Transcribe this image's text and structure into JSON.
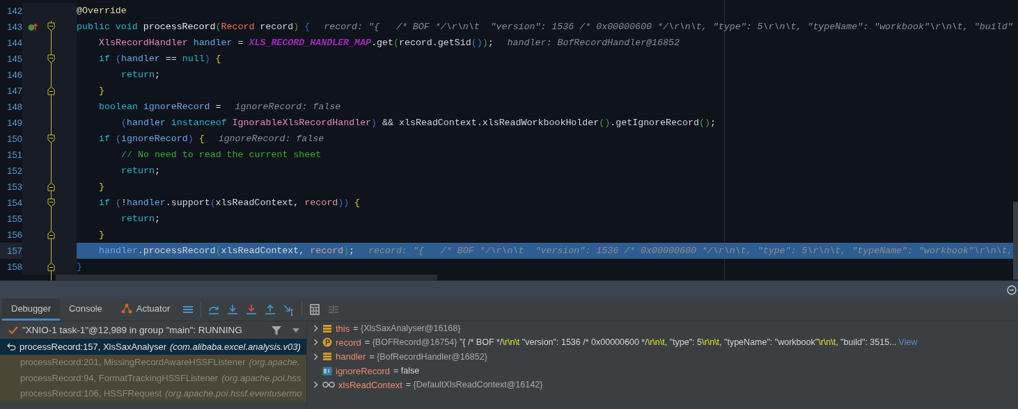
{
  "editor": {
    "lines": [
      {
        "number": "142",
        "fold_start": false,
        "fold_end": false,
        "overrides": false,
        "current": false,
        "tokens": [
          {
            "text": "@Override",
            "kind": "annotation"
          }
        ]
      },
      {
        "number": "143",
        "fold_start": true,
        "fold_end": false,
        "overrides": true,
        "current": false,
        "tokens": [
          {
            "text": "public void ",
            "kind": "kw"
          },
          {
            "text": "processRecord",
            "kind": "decl"
          },
          {
            "text": "(",
            "kind": "paren"
          },
          {
            "text": "Record",
            "kind": "type"
          },
          {
            "text": " record",
            "kind": "plain"
          },
          {
            "text": ")",
            "kind": "paren"
          },
          {
            "text": " {",
            "kind": "brace"
          }
        ],
        "hint": "record: \"{   /* BOF */\\r\\n\\t  \"version\": 1536 /* 0x00000600 */\\r\\n\\t, \"type\": 5\\r\\n\\t, \"typeName\": \"workbook\"\\r\\n\\t, \"build\"",
        "children": [
          {
            "number": "144",
            "fold_start": false,
            "fold_end": false,
            "overrides": false,
            "current": false,
            "tokens": [
              {
                "text": "XlsRecordHandler",
                "kind": "cls"
              },
              {
                "text": " handler",
                "kind": "local"
              },
              {
                "text": " = ",
                "kind": "plain"
              },
              {
                "text": "XLS_RECORD_HANDLER_MAP",
                "kind": "field"
              },
              {
                "text": ".get",
                "kind": "plain"
              },
              {
                "text": "(",
                "kind": "paren"
              },
              {
                "text": "record.getSid",
                "kind": "plain"
              },
              {
                "text": "()",
                "kind": "paren2"
              },
              {
                "text": ")",
                "kind": "paren"
              },
              {
                "text": ";",
                "kind": "plain"
              }
            ],
            "hint": "handler: BofRecordHandler@16852"
          },
          {
            "number": "145",
            "fold_start": true,
            "fold_end": false,
            "overrides": false,
            "current": false,
            "tokens": [
              {
                "text": "if ",
                "kind": "kw"
              },
              {
                "text": "(",
                "kind": "paren2"
              },
              {
                "text": "handler",
                "kind": "local"
              },
              {
                "text": " == ",
                "kind": "plain"
              },
              {
                "text": "null",
                "kind": "kw"
              },
              {
                "text": ")",
                "kind": "paren2"
              },
              {
                "text": " {",
                "kind": "brace2"
              }
            ],
            "children": [
              {
                "number": "146",
                "fold_start": false,
                "fold_end": false,
                "overrides": false,
                "current": false,
                "tokens": [
                  {
                    "text": "return",
                    "kind": "kw"
                  },
                  {
                    "text": ";",
                    "kind": "plain"
                  }
                ]
              }
            ]
          },
          {
            "number": "147",
            "fold_start": false,
            "fold_end": true,
            "overrides": false,
            "current": false,
            "tokens": [
              {
                "text": "}",
                "kind": "brace2"
              }
            ]
          },
          {
            "number": "148",
            "fold_start": false,
            "fold_end": false,
            "overrides": false,
            "current": false,
            "tokens": [
              {
                "text": "boolean ",
                "kind": "kw"
              },
              {
                "text": "ignoreRecord",
                "kind": "local"
              },
              {
                "text": " =",
                "kind": "plain"
              }
            ],
            "hint": "ignoreRecord: false",
            "children": [
              {
                "number": "149",
                "fold_start": false,
                "fold_end": false,
                "overrides": false,
                "current": false,
                "tokens": [
                  {
                    "text": "(",
                    "kind": "paren2"
                  },
                  {
                    "text": "handler",
                    "kind": "local"
                  },
                  {
                    "text": " instanceof ",
                    "kind": "kw"
                  },
                  {
                    "text": "IgnorableXlsRecordHandler",
                    "kind": "cls"
                  },
                  {
                    "text": ")",
                    "kind": "paren2"
                  },
                  {
                    "text": " && xlsReadContext.xlsReadWorkbookHolder",
                    "kind": "plain"
                  },
                  {
                    "text": "()",
                    "kind": "paren"
                  },
                  {
                    "text": ".getIgnoreRecord",
                    "kind": "plain"
                  },
                  {
                    "text": "()",
                    "kind": "paren"
                  },
                  {
                    "text": ";",
                    "kind": "plain"
                  }
                ]
              }
            ]
          },
          {
            "number": "150",
            "fold_start": true,
            "fold_end": false,
            "overrides": false,
            "current": false,
            "tokens": [
              {
                "text": "if ",
                "kind": "kw"
              },
              {
                "text": "(",
                "kind": "paren2"
              },
              {
                "text": "ignoreRecord",
                "kind": "local"
              },
              {
                "text": ")",
                "kind": "paren2"
              },
              {
                "text": " {",
                "kind": "brace2"
              }
            ],
            "hint": "ignoreRecord: false",
            "children": [
              {
                "number": "151",
                "fold_start": false,
                "fold_end": false,
                "overrides": false,
                "current": false,
                "tokens": [
                  {
                    "text": "// No need to read the current sheet",
                    "kind": "comment"
                  }
                ]
              },
              {
                "number": "152",
                "fold_start": false,
                "fold_end": false,
                "overrides": false,
                "current": false,
                "tokens": [
                  {
                    "text": "return",
                    "kind": "kw"
                  },
                  {
                    "text": ";",
                    "kind": "plain"
                  }
                ]
              }
            ]
          },
          {
            "number": "153",
            "fold_start": false,
            "fold_end": true,
            "overrides": false,
            "current": false,
            "tokens": [
              {
                "text": "}",
                "kind": "brace2"
              }
            ]
          },
          {
            "number": "154",
            "fold_start": true,
            "fold_end": false,
            "overrides": false,
            "current": false,
            "tokens": [
              {
                "text": "if ",
                "kind": "kw"
              },
              {
                "text": "(",
                "kind": "paren2"
              },
              {
                "text": "!",
                "kind": "plain"
              },
              {
                "text": "handler",
                "kind": "local"
              },
              {
                "text": ".support",
                "kind": "plain"
              },
              {
                "text": "(",
                "kind": "paren2"
              },
              {
                "text": "xlsReadContext, ",
                "kind": "plain"
              },
              {
                "text": "record",
                "kind": "param"
              },
              {
                "text": "))",
                "kind": "paren2"
              },
              {
                "text": " {",
                "kind": "brace2"
              }
            ],
            "children": [
              {
                "number": "155",
                "fold_start": false,
                "fold_end": false,
                "overrides": false,
                "current": false,
                "tokens": [
                  {
                    "text": "return",
                    "kind": "kw"
                  },
                  {
                    "text": ";",
                    "kind": "plain"
                  }
                ]
              }
            ]
          },
          {
            "number": "156",
            "fold_start": false,
            "fold_end": true,
            "overrides": false,
            "current": false,
            "tokens": [
              {
                "text": "}",
                "kind": "brace2"
              }
            ]
          },
          {
            "number": "157",
            "fold_start": false,
            "fold_end": false,
            "overrides": false,
            "current": true,
            "tokens": [
              {
                "text": "handler",
                "kind": "local"
              },
              {
                "text": ".processRecord",
                "kind": "plain"
              },
              {
                "text": "(",
                "kind": "paren"
              },
              {
                "text": "xlsReadContext, ",
                "kind": "plain"
              },
              {
                "text": "record",
                "kind": "param"
              },
              {
                "text": ")",
                "kind": "paren"
              },
              {
                "text": ";",
                "kind": "plain"
              }
            ],
            "hint": "record: \"{   /* BOF */\\r\\n\\t  \"version\": 1536 /* 0x00000600 */\\r\\n\\t, \"type\": 5\\r\\n\\t, \"typeName\": \"workbook\"\\r\\n\\t,"
          }
        ]
      },
      {
        "number": "158",
        "fold_start": false,
        "fold_end": true,
        "overrides": false,
        "current": false,
        "tokens": [
          {
            "text": "}",
            "kind": "brace"
          }
        ]
      }
    ]
  },
  "debug_panel": {
    "tabs": [
      {
        "label": "Debugger",
        "selected": true,
        "icon": false
      },
      {
        "label": "Console",
        "selected": false,
        "icon": false
      },
      {
        "label": "Actuator",
        "selected": false,
        "icon": true
      }
    ],
    "thread": {
      "label": "\"XNIO-1 task-1\"@12,989 in group \"main\": RUNNING",
      "running": true
    },
    "frames": [
      {
        "location": "processRecord:157, XlsSaxAnalyser",
        "package": "(com.alibaba.excel.analysis.v03)",
        "selected": true,
        "library": false
      },
      {
        "location": "processRecord:201, MissingRecordAwareHSSFListener",
        "package": "(org.apache.",
        "selected": false,
        "library": true
      },
      {
        "location": "processRecord:94, FormatTrackingHSSFListener",
        "package": "(org.apache.poi.hss",
        "selected": false,
        "library": true
      },
      {
        "location": "processRecord:106, HSSFRequest",
        "package": "(org.apache.poi.hssf.eventusermo",
        "selected": false,
        "library": true
      }
    ],
    "variables": [
      {
        "kind": "field",
        "name": "this",
        "operator": "=",
        "expandable": true,
        "value": [
          {
            "text": "{XlsSaxAnalyser@16168}",
            "kind": "ref"
          }
        ]
      },
      {
        "kind": "param",
        "name": "record",
        "operator": "=",
        "expandable": true,
        "value": [
          {
            "text": "{BOFRecord@16754}",
            "kind": "ref"
          },
          {
            "text": " \"{   /* BOF */",
            "kind": "string"
          },
          {
            "text": "\\r\\n\\t",
            "kind": "escape"
          },
          {
            "text": "  \"version\": 1536 /* 0x00000600 */",
            "kind": "string"
          },
          {
            "text": "\\r\\n\\t",
            "kind": "escape"
          },
          {
            "text": ", \"type\": 5",
            "kind": "string"
          },
          {
            "text": "\\r\\n\\t",
            "kind": "escape"
          },
          {
            "text": ", \"typeName\": \"workbook\"",
            "kind": "string"
          },
          {
            "text": "\\r\\n\\t",
            "kind": "escape"
          },
          {
            "text": ", \"build\": 3515...",
            "kind": "string"
          }
        ],
        "link": "View"
      },
      {
        "kind": "field",
        "name": "handler",
        "operator": "=",
        "expandable": true,
        "value": [
          {
            "text": "{BofRecordHandler@16852}",
            "kind": "ref"
          }
        ]
      },
      {
        "kind": "primitive",
        "name": "ignoreRecord",
        "operator": "=",
        "expandable": false,
        "value": [
          {
            "text": "false",
            "kind": "string"
          }
        ]
      },
      {
        "kind": "watch",
        "name": "xlsReadContext",
        "operator": "=",
        "expandable": true,
        "value": [
          {
            "text": "{DefaultXlsReadContext@16142}",
            "kind": "ref"
          }
        ]
      }
    ]
  }
}
